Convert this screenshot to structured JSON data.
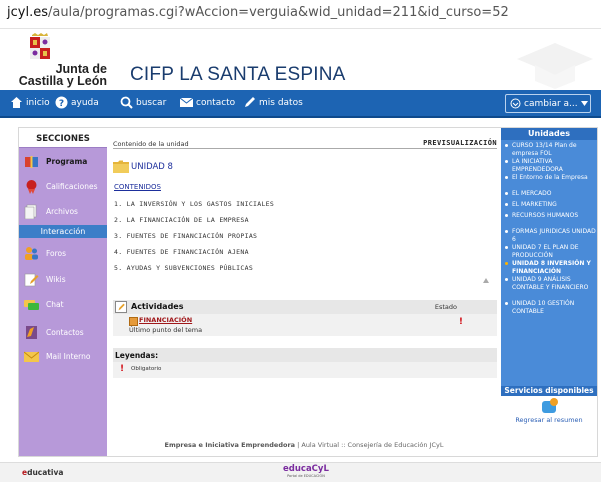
{
  "browser": {
    "url_domain": "jcyl.es",
    "url_path": "/aula/programas.cgi?wAccion=verguia&wid_unidad=211&id_curso=52"
  },
  "header": {
    "logo_line1": "Junta de",
    "logo_line2": "Castilla y León",
    "site_title": "CIFP LA SANTA ESPINA"
  },
  "navbar": {
    "inicio": "inicio",
    "ayuda": "ayuda",
    "buscar": "buscar",
    "contacto": "contacto",
    "mis_datos": "mis datos",
    "cambiar": "cambiar a..."
  },
  "sidebar": {
    "title": "SECCIONES",
    "items": [
      {
        "label": "Programa",
        "icon": "book-icon"
      },
      {
        "label": "Calificaciones",
        "icon": "ribbon-icon"
      },
      {
        "label": "Archivos",
        "icon": "files-icon"
      }
    ],
    "section_label": "Interacción",
    "items2": [
      {
        "label": "Foros",
        "icon": "people-icon"
      },
      {
        "label": "Wikis",
        "icon": "pencil-icon"
      },
      {
        "label": "Chat",
        "icon": "chat-icon"
      },
      {
        "label": "Contactos",
        "icon": "contacts-icon"
      },
      {
        "label": "Mail Interno",
        "icon": "mail-icon"
      }
    ]
  },
  "content": {
    "header_label": "Contenido de la unidad",
    "preview_label": "PREVISUALIZACIÓN",
    "unit_title": "UNIDAD 8",
    "contenidos_link": "CONTENIDOS",
    "items": [
      "1. LA INVERSIÓN Y LOS GASTOS INICIALES",
      "2. LA FINANCIACIÓN DE LA EMPRESA",
      "3. FUENTES DE FINANCIACIÓN PROPIAS",
      "4. FUENTES DE FINANCIACIÓN AJENA",
      "5. AYUDAS Y SUBVENCIONES PÚBLICAS"
    ],
    "actividades_title": "Actividades",
    "estado_label": "Estado",
    "activity_link": "FINANCIACIÓN",
    "activity_sub": "Último punto del tema",
    "exclamation": "!",
    "leyendas_title": "Leyendas:",
    "obligatorio_label": "Obligatorio",
    "footer_bold": "Empresa e Iniciativa Emprendedora",
    "footer_rest": " | Aula Virtual :: Consejería de Educación JCyL"
  },
  "rsidebar": {
    "title": "Unidades",
    "units": [
      "CURSO 13/14 Plan de empresa FOL",
      "LA INICIATIVA EMPRENDEDORA",
      "El Entorno de la Empresa",
      "EL MERCADO",
      "EL MARKETING",
      "RECURSOS HUMANOS",
      "FORMAS JURIDICAS UNIDAD 6",
      "UNIDAD 7 EL PLAN DE PRODUCCIÓN",
      "UNIDAD 8 INVERSIÓN Y FINANCIACIÓN",
      "UNIDAD 9 ANÁLISIS CONTABLE Y FINANCIERO",
      "UNIDAD 10 GESTIÓN CONTABLE"
    ],
    "active_index": 8,
    "services_title": "Servicios disponibles",
    "services_link": "Regresar al resumen"
  },
  "bottom": {
    "educativa_e": "e",
    "educativa_rest": "ducativa",
    "educacyl_big": "educaCyL",
    "educacyl_small": "Portal de EDUCACIÓN"
  },
  "colors": {
    "nav_blue": "#1d64b3",
    "sidebar_purple": "#b799d9",
    "right_blue": "#4a8bd8",
    "title_blue": "#1a3c6e",
    "alert_red": "#d2121a"
  }
}
